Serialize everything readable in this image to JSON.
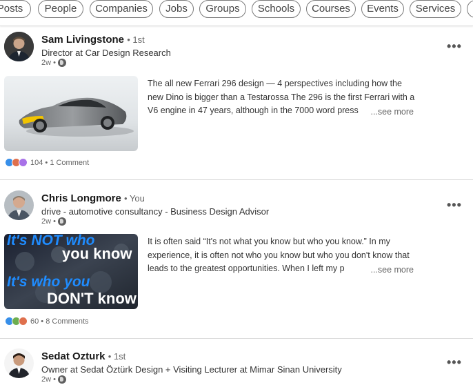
{
  "filters": [
    "Posts",
    "People",
    "Companies",
    "Jobs",
    "Groups",
    "Schools",
    "Courses",
    "Events",
    "Services"
  ],
  "posts": [
    {
      "name": "Sam Livingstone",
      "degree": "• 1st",
      "headline": "Director at Car Design Research",
      "age": "2w •",
      "excerpt": "The all new Ferrari 296 design — 4 perspectives including how the new Dino is bigger than a Testarossa The 296 is the first Ferrari with a V6 engine in 47 years, although in the 7000 word press",
      "see_more": "...see more",
      "reactions": "104 • 1 Comment",
      "reaction_icons": [
        "like-icon",
        "love-icon",
        "support-icon"
      ]
    },
    {
      "name": "Chris Longmore",
      "degree": "• You",
      "headline": "drive - automotive consultancy - Business Design Advisor",
      "age": "2w •",
      "excerpt": "It is often said “It's not what you know but who you know.” In my experience, it is often not who you know but who you don't know that leads to the greatest opportunities. When I left my p",
      "see_more": "...see more",
      "reactions": "60 • 8 Comments",
      "reaction_icons": [
        "like-icon",
        "celebrate-icon",
        "love-icon"
      ],
      "image_text": [
        "It's NOT who",
        "you know",
        "It's who you",
        "DON'T know"
      ]
    },
    {
      "name": "Sedat Ozturk",
      "degree": "• 1st",
      "headline": "Owner at Sedat Öztürk Design + Visiting Lecturer at Mimar Sinan University",
      "age": "2w •"
    }
  ],
  "more_icon": "•••",
  "colors": {
    "like": "#378fe9",
    "love": "#df704d",
    "support": "#a872e8",
    "celebrate": "#6dae4f"
  }
}
